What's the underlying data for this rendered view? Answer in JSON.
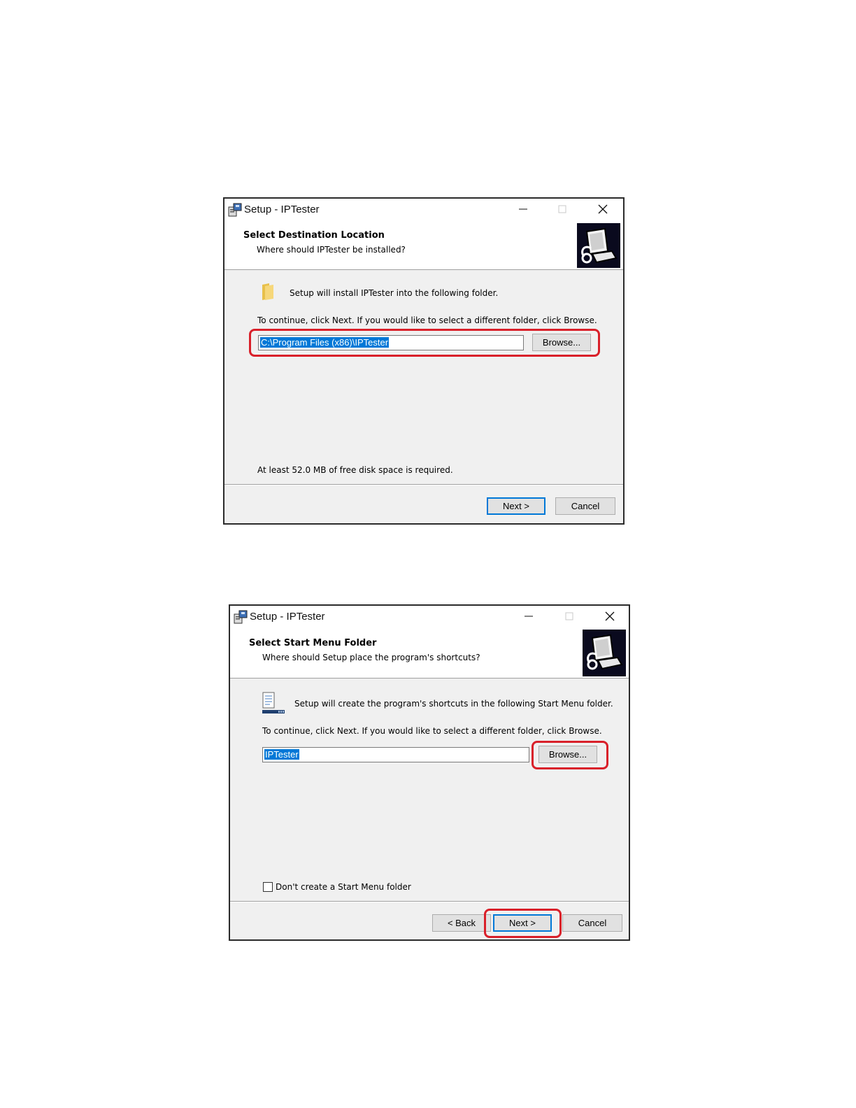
{
  "dialog1": {
    "title": "Setup - IPTester",
    "header_title": "Select Destination Location",
    "header_subtitle": "Where should IPTester be installed?",
    "intro_text": "Setup will install IPTester into the following folder.",
    "instruction_text": "To continue, click Next. If you would like to select a different folder, click Browse.",
    "folder_value": "C:\\Program Files (x86)\\IPTester",
    "browse_label": "Browse...",
    "disk_space_text": "At least 52.0 MB of free disk space is required.",
    "next_label": "Next >",
    "cancel_label": "Cancel"
  },
  "dialog2": {
    "title": "Setup - IPTester",
    "header_title": "Select Start Menu Folder",
    "header_subtitle": "Where should Setup place the program's shortcuts?",
    "intro_text": "Setup will create the program's shortcuts in the following Start Menu folder.",
    "instruction_text": "To continue, click Next. If you would like to select a different folder, click Browse.",
    "folder_value": "IPTester",
    "browse_label": "Browse...",
    "checkbox_label": "Don't create a Start Menu folder",
    "checkbox_checked": false,
    "back_label": "< Back",
    "next_label": "Next >",
    "cancel_label": "Cancel"
  },
  "colors": {
    "highlight": "#d9202a",
    "selection": "#0078d7",
    "dialog_bg": "#f0f0f0"
  }
}
